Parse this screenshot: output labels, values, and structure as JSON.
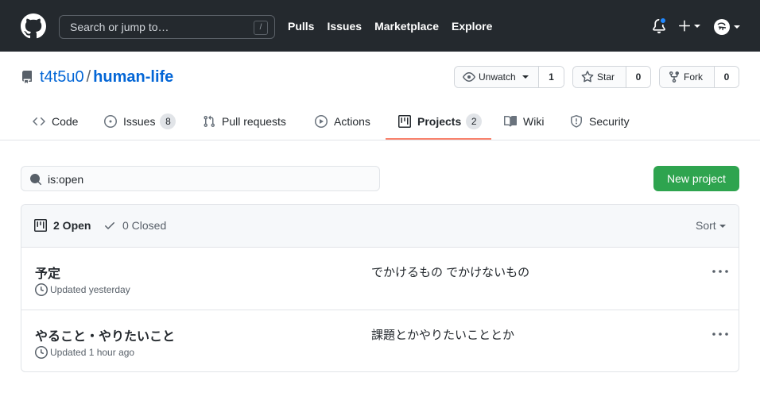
{
  "header": {
    "search_placeholder": "Search or jump to…",
    "search_shortcut": "/",
    "nav": [
      "Pulls",
      "Issues",
      "Marketplace",
      "Explore"
    ],
    "notification_color": "#2188ff"
  },
  "repo": {
    "owner": "t4t5u0",
    "separator": "/",
    "name": "human-life",
    "watch": {
      "label": "Unwatch",
      "count": "1"
    },
    "star": {
      "label": "Star",
      "count": "0"
    },
    "fork": {
      "label": "Fork",
      "count": "0"
    }
  },
  "tabs": [
    {
      "label": "Code",
      "icon": "code-icon"
    },
    {
      "label": "Issues",
      "icon": "issue-icon",
      "count": "8"
    },
    {
      "label": "Pull requests",
      "icon": "pull-request-icon"
    },
    {
      "label": "Actions",
      "icon": "play-icon"
    },
    {
      "label": "Projects",
      "icon": "project-icon",
      "count": "2",
      "active": true
    },
    {
      "label": "Wiki",
      "icon": "book-icon"
    },
    {
      "label": "Security",
      "icon": "shield-icon"
    }
  ],
  "projects": {
    "search_value": "is:open",
    "new_button": "New project",
    "open_label": "2 Open",
    "closed_label": "0 Closed",
    "sort_label": "Sort",
    "items": [
      {
        "name": "予定",
        "updated": "Updated yesterday",
        "description": "でかけるもの でかけないもの"
      },
      {
        "name": "やること・やりたいこと",
        "updated": "Updated 1 hour ago",
        "description": "課題とかやりたいこととか"
      }
    ]
  },
  "colors": {
    "header_bg": "#24292e",
    "link": "#0366d6",
    "primary_button": "#2ea44f",
    "active_tab_underline": "#f9826c"
  }
}
